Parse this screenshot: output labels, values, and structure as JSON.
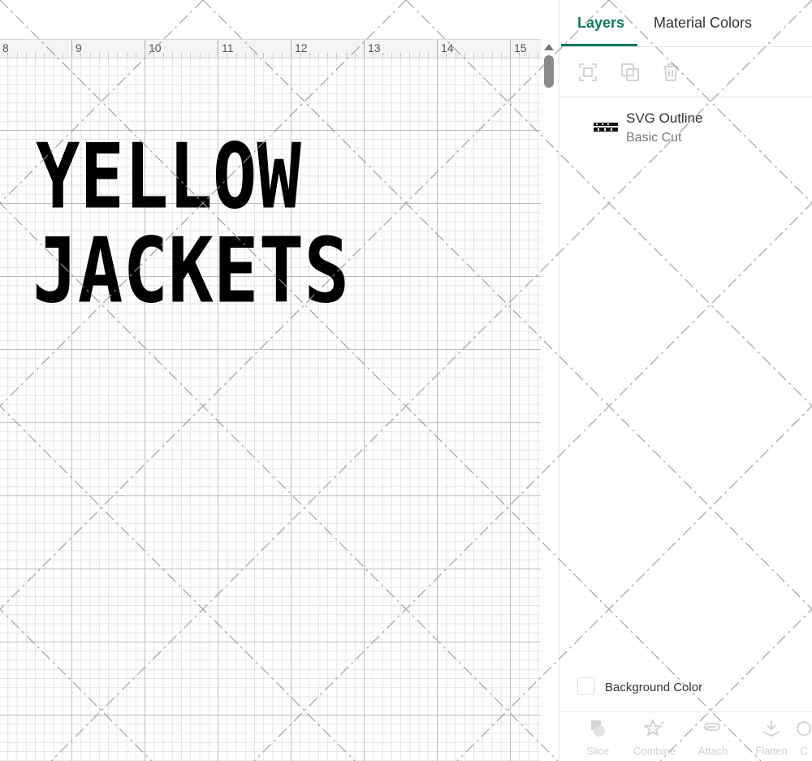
{
  "ruler": {
    "labels": [
      "8",
      "9",
      "10",
      "11",
      "12",
      "13",
      "14",
      "15"
    ]
  },
  "canvas": {
    "design_line1": "YELLOW",
    "design_line2": "JACKETS"
  },
  "panel": {
    "tabs": [
      {
        "label": "Layers",
        "active": true
      },
      {
        "label": "Material Colors",
        "active": false
      }
    ],
    "toolbar": {
      "icons": [
        "group-icon",
        "duplicate-icon",
        "delete-icon"
      ]
    },
    "layers": [
      {
        "name": "SVG Outline",
        "operation": "Basic Cut",
        "thumbnail": "yellow-jackets-thumbnail"
      }
    ],
    "background_color_label": "Background Color",
    "bottom_actions": [
      {
        "label": "Slice",
        "icon": "slice-icon"
      },
      {
        "label": "Combine",
        "icon": "combine-icon"
      },
      {
        "label": "Attach",
        "icon": "attach-icon"
      },
      {
        "label": "Flatten",
        "icon": "flatten-icon"
      },
      {
        "label": "C",
        "icon": "contour-icon"
      }
    ]
  },
  "colors": {
    "accent": "#0f7a5c",
    "design": "#000000",
    "disabled": "#d0d0d0"
  }
}
